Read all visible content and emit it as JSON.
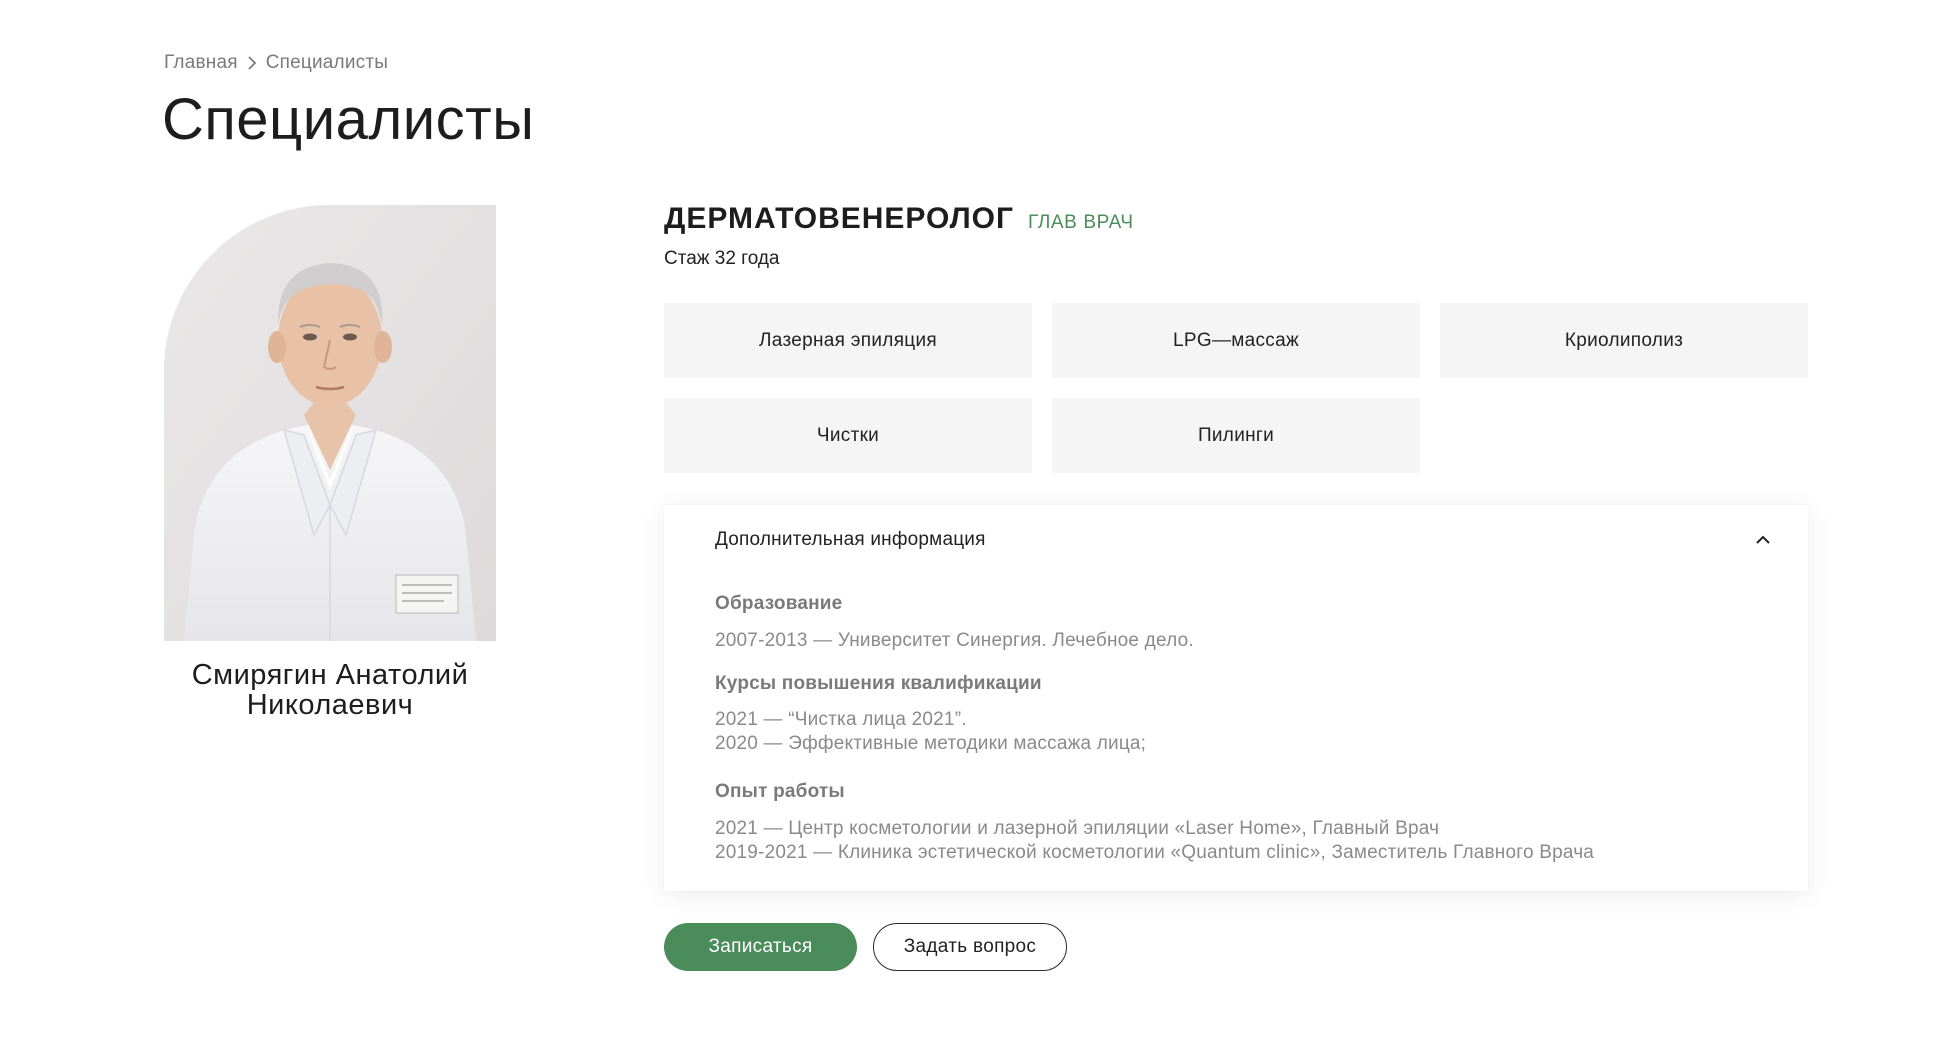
{
  "breadcrumb": {
    "items": [
      {
        "label": "Главная"
      },
      {
        "label": "Специалисты"
      }
    ]
  },
  "page": {
    "title": "Специалисты"
  },
  "doctor": {
    "name_line1": "Смирягин Анатолий",
    "name_line2": "Николаевич",
    "specialty": "ДЕРМАТОВЕНЕРОЛОГ",
    "badge": "ГЛАВ ВРАЧ",
    "experience": "Стаж 32 года"
  },
  "services": [
    {
      "label": "Лазерная эпиляция"
    },
    {
      "label": "LPG—массаж"
    },
    {
      "label": "Криолиполиз"
    },
    {
      "label": "Чистки"
    },
    {
      "label": "Пилинги"
    }
  ],
  "info": {
    "header": "Дополнительная информация",
    "expanded": true,
    "education": {
      "title": "Образование",
      "lines": [
        "2007-2013 — Университет Синергия. Лечебное дело."
      ]
    },
    "courses": {
      "title": "Курсы повышения квалификации",
      "lines": [
        "2021 — “Чистка лица 2021”.",
        "2020 — Эффективные методики массажа лица;"
      ]
    },
    "work": {
      "title": "Опыт работы",
      "lines": [
        "2021 — Центр косметологии и лазерной эпиляции «Laser Home», Главный Врач",
        "2019-2021 — Клиника эстетической косметологии «Quantum clinic», Заместитель Главного Врача"
      ]
    }
  },
  "actions": {
    "book_label": "Записаться",
    "ask_label": "Задать вопрос"
  },
  "colors": {
    "accent": "#4a8c5a",
    "text": "#222222",
    "muted": "#7a7a7a",
    "service_bg": "#f5f5f5"
  },
  "icons": {
    "breadcrumb_separator": "chevron-right-icon",
    "collapse": "chevron-up-icon"
  }
}
